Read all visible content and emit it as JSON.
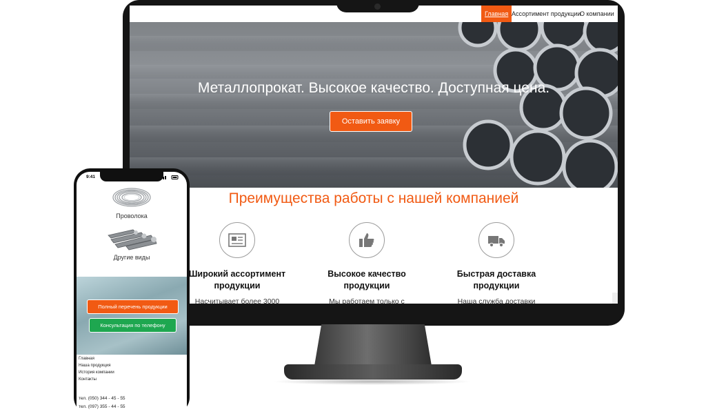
{
  "desktop": {
    "nav": [
      {
        "label": "Главная",
        "active": true
      },
      {
        "label": "Ассортимент продукции",
        "active": false
      },
      {
        "label": "О компании",
        "active": false
      }
    ],
    "hero": {
      "title": "Металлопрокат. Высокое качество. Доступная цена.",
      "button": "Оставить заявку"
    },
    "advantages": {
      "title": "Преимущества работы с нашей компанией",
      "items": [
        {
          "icon": "newspaper-icon",
          "line1": "Широкий ассортимент",
          "line2": "продукции",
          "text": "Насчитывает более 3000"
        },
        {
          "icon": "thumbs-up-icon",
          "line1": "Высокое качество",
          "line2": "продукции",
          "text": "Мы работаем только с"
        },
        {
          "icon": "truck-icon",
          "line1": "Быстрая доставка",
          "line2": "продукции",
          "text": "Наша служба доставки"
        }
      ]
    }
  },
  "mobile": {
    "status_time": "9:41",
    "products": [
      {
        "label": "Проволока",
        "icon": "wire-coil-image"
      },
      {
        "label": "Другие виды",
        "icon": "metal-profiles-image"
      }
    ],
    "buttons": {
      "full_list": "Полный перечень продукции",
      "phone_consult": "Консультация по телефону"
    },
    "menu": [
      "Главная",
      "Наша продукция",
      "История компании",
      "Контакты"
    ],
    "phones": [
      "тел. (050) 344 - 45 - 55",
      "тел. (097) 355 - 44 - 55"
    ]
  },
  "colors": {
    "accent": "#f15a13",
    "green": "#1ea750",
    "device": "#151515"
  }
}
